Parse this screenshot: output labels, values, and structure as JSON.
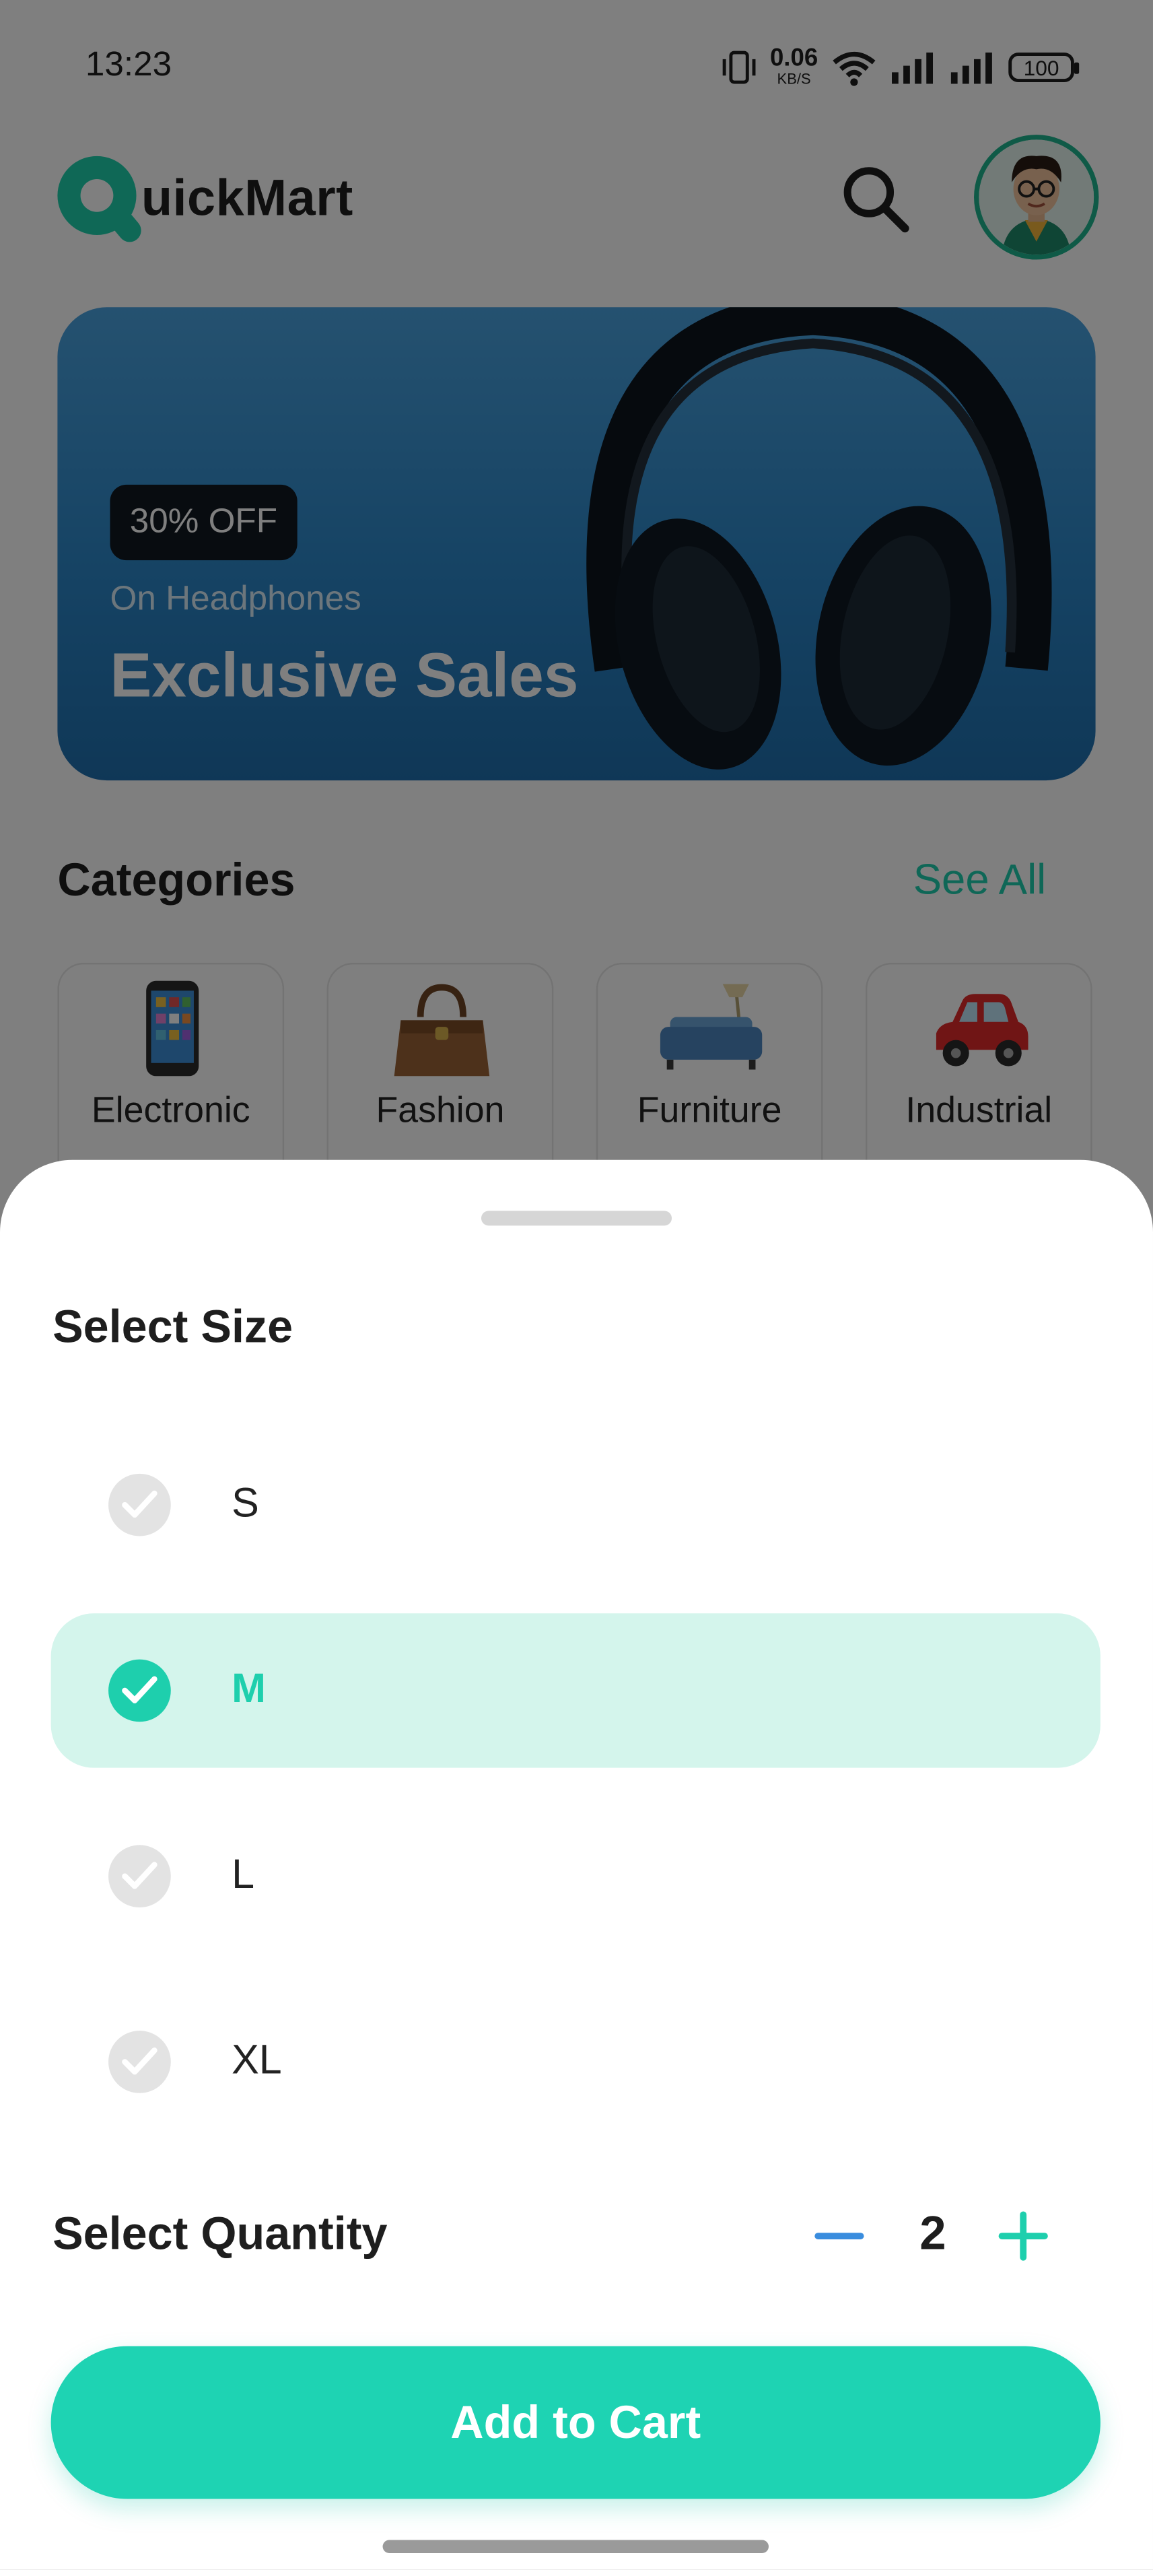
{
  "status_bar": {
    "time": "13:23",
    "net_speed": "0.06",
    "net_unit": "KB/S",
    "battery": "100",
    "icons": [
      "vibrate-icon",
      "wifi-icon",
      "signal-icon",
      "signal-icon",
      "battery-icon"
    ]
  },
  "header": {
    "logo_text": "uickMart",
    "icons": [
      "logo-q-icon",
      "search-icon",
      "avatar"
    ]
  },
  "banner": {
    "badge": "30% OFF",
    "subtitle": "On Headphones",
    "title": "Exclusive Sales",
    "image": "headphones-image"
  },
  "categories": {
    "title": "Categories",
    "see_all": "See All",
    "items": [
      {
        "label": "Electronic",
        "icon": "smartphone-icon"
      },
      {
        "label": "Fashion",
        "icon": "handbag-icon"
      },
      {
        "label": "Furniture",
        "icon": "sofa-icon"
      },
      {
        "label": "Industrial",
        "icon": "car-icon"
      }
    ]
  },
  "size_sheet": {
    "title": "Select Size",
    "options": [
      {
        "label": "S",
        "selected": false
      },
      {
        "label": "M",
        "selected": true
      },
      {
        "label": "L",
        "selected": false
      },
      {
        "label": "XL",
        "selected": false
      }
    ],
    "quantity_title": "Select Quantity",
    "quantity": "2",
    "add_to_cart": "Add to Cart"
  },
  "colors": {
    "accent": "#1ED3B3",
    "selected_bg": "#D4F5EC",
    "minus_blue": "#3A8DDE",
    "scrim": "rgba(0,0,0,0.5)"
  }
}
